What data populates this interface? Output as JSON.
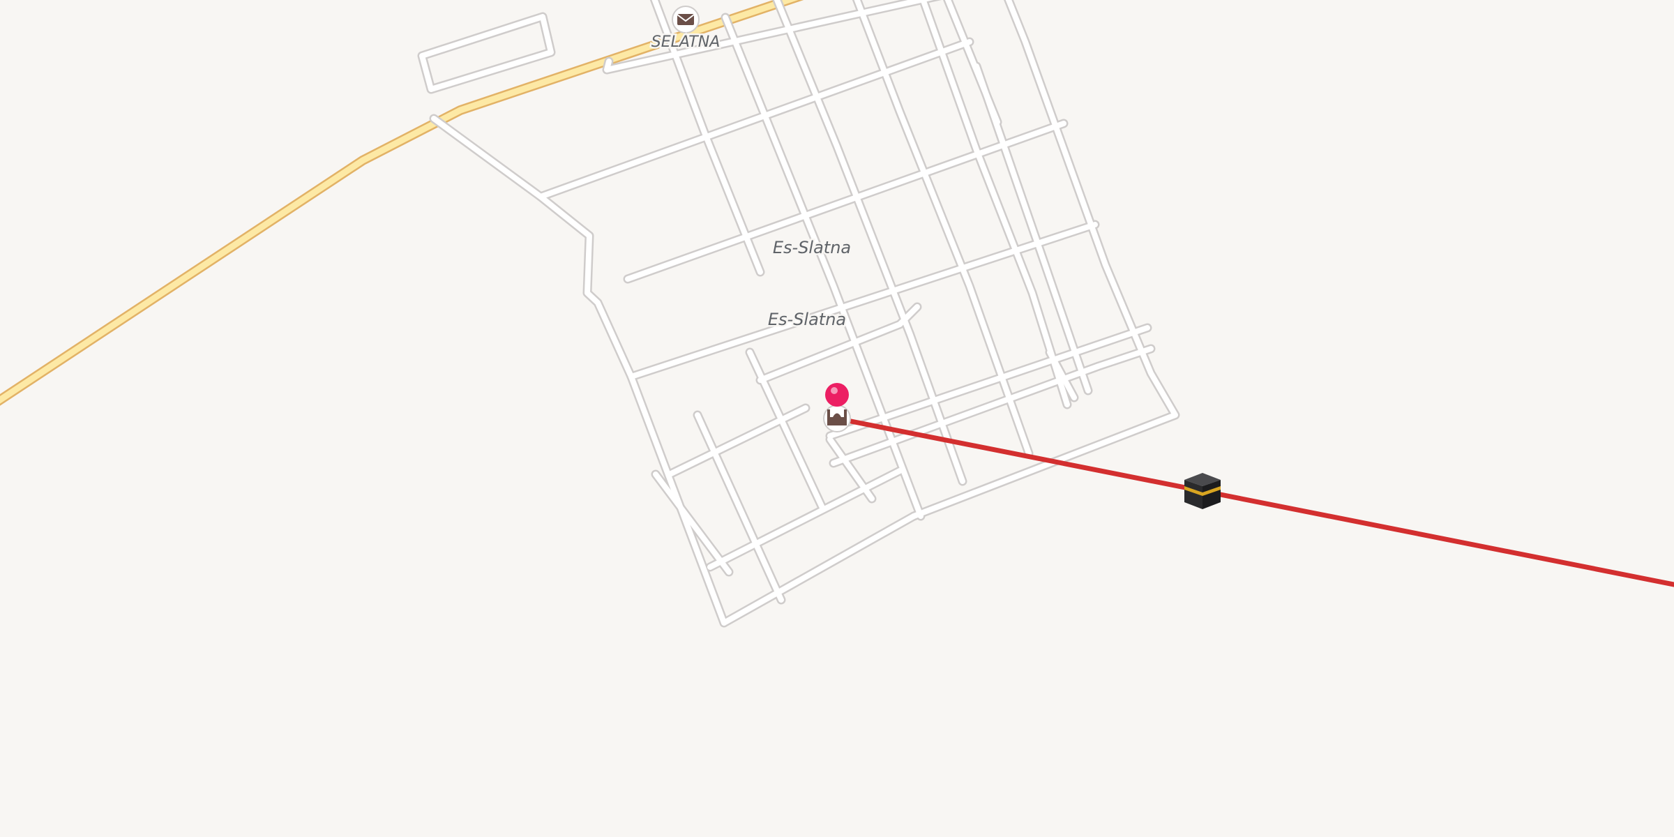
{
  "map": {
    "background": "#f8f6f3",
    "labels": {
      "post_office_label": "SELATNA",
      "district_label_1": "Es-Slatna",
      "district_label_2": "Es-Slatna"
    },
    "colors": {
      "road_casing": "#cfcccb",
      "road_fill": "#ffffff",
      "highway_casing": "#e2b266",
      "highway_fill": "#fde9a5",
      "qibla_line": "#d32f2f",
      "marker": "#ec1f63",
      "poi_icon": "#6b4f48"
    },
    "icons": {
      "post_office": "envelope-icon",
      "mosque": "mosque-icon",
      "kaaba": "kaaba-icon",
      "location_pin": "location-pin-icon"
    }
  }
}
